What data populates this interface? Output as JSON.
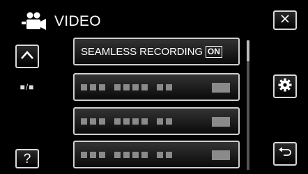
{
  "header": {
    "title": "VIDEO",
    "icon": "video-camera-icon"
  },
  "controls": {
    "close_icon": "close-icon",
    "up_icon": "chevron-up-icon",
    "page_indicator": "■/■",
    "help_label": "?",
    "settings_icon": "gear-icon",
    "back_icon": "return-arrow-icon"
  },
  "menu": {
    "items": [
      {
        "label": "SEAMLESS RECORDING",
        "value": "ON"
      },
      {
        "label": "",
        "value": ""
      },
      {
        "label": "",
        "value": ""
      },
      {
        "label": "",
        "value": ""
      }
    ]
  },
  "colors": {
    "background": "#000000",
    "button_border": "#d0d0d0",
    "text": "#ffffff",
    "placeholder": "#8a8a8a"
  }
}
